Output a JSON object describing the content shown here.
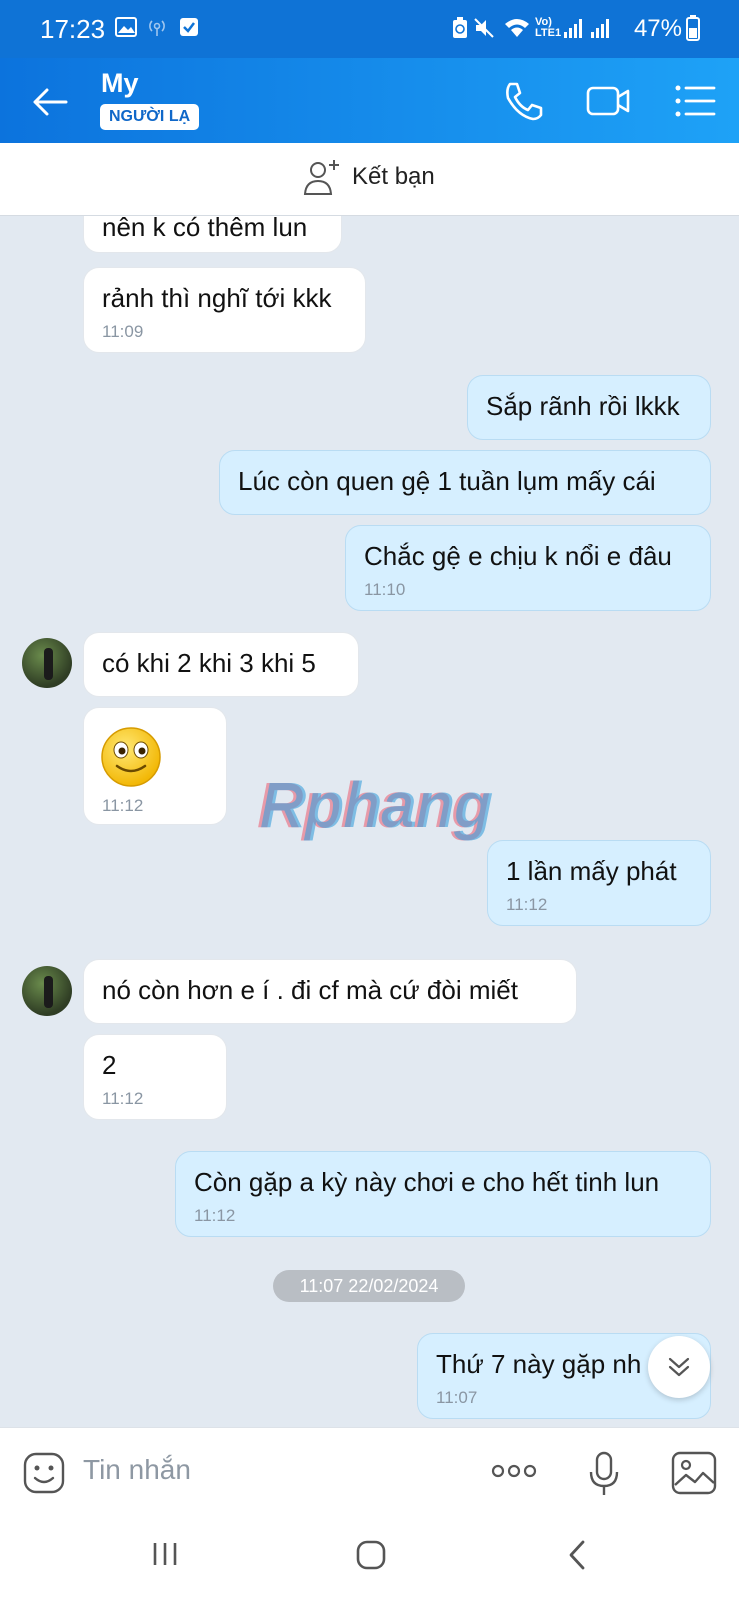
{
  "status_bar": {
    "time": "17:23",
    "network_label": "Vo) LTE1",
    "battery": "47%"
  },
  "header": {
    "contact_name": "My",
    "badge": "NGƯỜI LẠ",
    "icons": [
      "back-arrow-icon",
      "phone-icon",
      "video-call-icon",
      "menu-list-icon"
    ]
  },
  "add_friend": {
    "label": "Kết bạn"
  },
  "messages": [
    {
      "side": "in",
      "text": "nên k có thêm lun",
      "time": ""
    },
    {
      "side": "in",
      "text": "rảnh thì nghĩ tới kkk",
      "time": "11:09"
    },
    {
      "side": "out",
      "text": "Sắp rãnh rồi lkkk",
      "time": ""
    },
    {
      "side": "out",
      "text": "Lúc còn quen gệ 1 tuần lụm mấy cái",
      "time": ""
    },
    {
      "side": "out",
      "text": "Chắc gệ e chịu k nổi e đâu",
      "time": "11:10"
    },
    {
      "side": "in",
      "text": "có khi 2 khi 3 khi 5",
      "time": ""
    },
    {
      "side": "in",
      "text": "",
      "sticker": "smiley-sticker",
      "time": "11:12"
    },
    {
      "side": "out",
      "text": "1 lần mấy phát",
      "time": "11:12"
    },
    {
      "side": "in",
      "text": "nó còn hơn e í . đi cf mà cứ đòi miết",
      "time": ""
    },
    {
      "side": "in",
      "text": "2",
      "time": "11:12"
    },
    {
      "side": "out",
      "text": "Còn gặp a kỳ này chơi e cho hết tinh lun",
      "time": "11:12"
    },
    {
      "side": "out",
      "text": "Thứ 7 này gặp nh",
      "time": "11:07"
    }
  ],
  "date_separator": "11:07 22/02/2024",
  "watermark": "Rphang",
  "input": {
    "placeholder": "Tin nhắn"
  },
  "colors": {
    "header_start": "#0c73dd",
    "header_end": "#1ea2f7",
    "outgoing_bubble": "#d6efff",
    "incoming_bubble": "#ffffff",
    "chat_background": "#e2e9f1"
  }
}
